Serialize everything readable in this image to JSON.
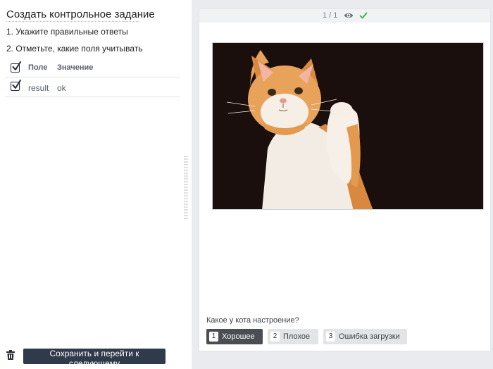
{
  "left": {
    "title": "Создать контрольное задание",
    "step1": "1. Укажите правильные ответы",
    "step2": "2. Отметьте, какие поля учитывать",
    "table": {
      "header": {
        "field": "Поле",
        "value": "Значение",
        "checked": true
      },
      "rows": [
        {
          "field": "result",
          "value": "ok",
          "checked": true
        }
      ]
    },
    "save_label": "Сохранить и перейти к следующему"
  },
  "card": {
    "counter": "1 / 1",
    "question": "Какое у кота настроение?",
    "answers": [
      {
        "key": "1",
        "label": "Хорошее",
        "selected": true
      },
      {
        "key": "2",
        "label": "Плохое",
        "selected": false
      },
      {
        "key": "3",
        "label": "Ошибка загрузки",
        "selected": false
      }
    ]
  },
  "colors": {
    "save_button": "#2f3a4a",
    "check_accent": "#2db34a",
    "selected_answer": "#4a4d52",
    "photo_background": "#1a0f0c"
  },
  "icons": [
    "trash-icon",
    "eye-icon",
    "check-icon",
    "checkbox-checked-icon"
  ]
}
